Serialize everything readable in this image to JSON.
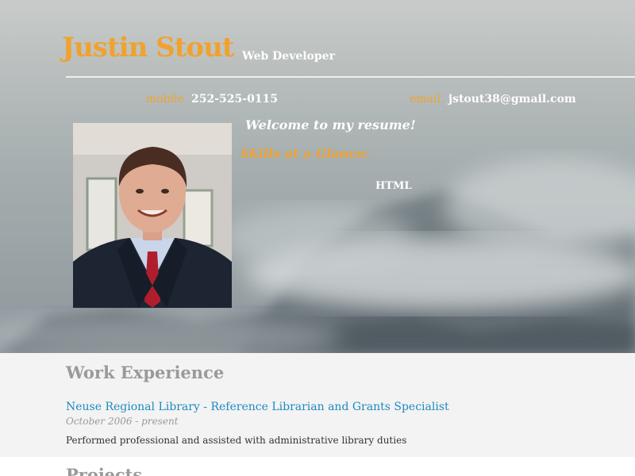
{
  "header": {
    "name": "Justin Stout",
    "role": "Web Developer"
  },
  "contact": {
    "mobile_label": "mobile",
    "mobile_value": "252-525-0115",
    "email_label": "email",
    "email_value": "jstout38@gmail.com"
  },
  "profile": {
    "welcome": "Welcome to my resume!",
    "skills_title": "Skills at a Glance:",
    "skills": [
      "HTML"
    ]
  },
  "work": {
    "title": "Work Experience",
    "jobs": [
      {
        "title": "Neuse Regional Library - Reference Librarian and Grants Specialist",
        "dates": "October 2006 - present",
        "description": "Performed professional and assisted with administrative library duties"
      }
    ]
  },
  "projects": {
    "title": "Projects"
  },
  "colors": {
    "accent": "#f0a22f",
    "link": "#1f8ac0",
    "heading_gray": "#9a9a9a"
  },
  "icons": {
    "photo": "profile-photo"
  }
}
